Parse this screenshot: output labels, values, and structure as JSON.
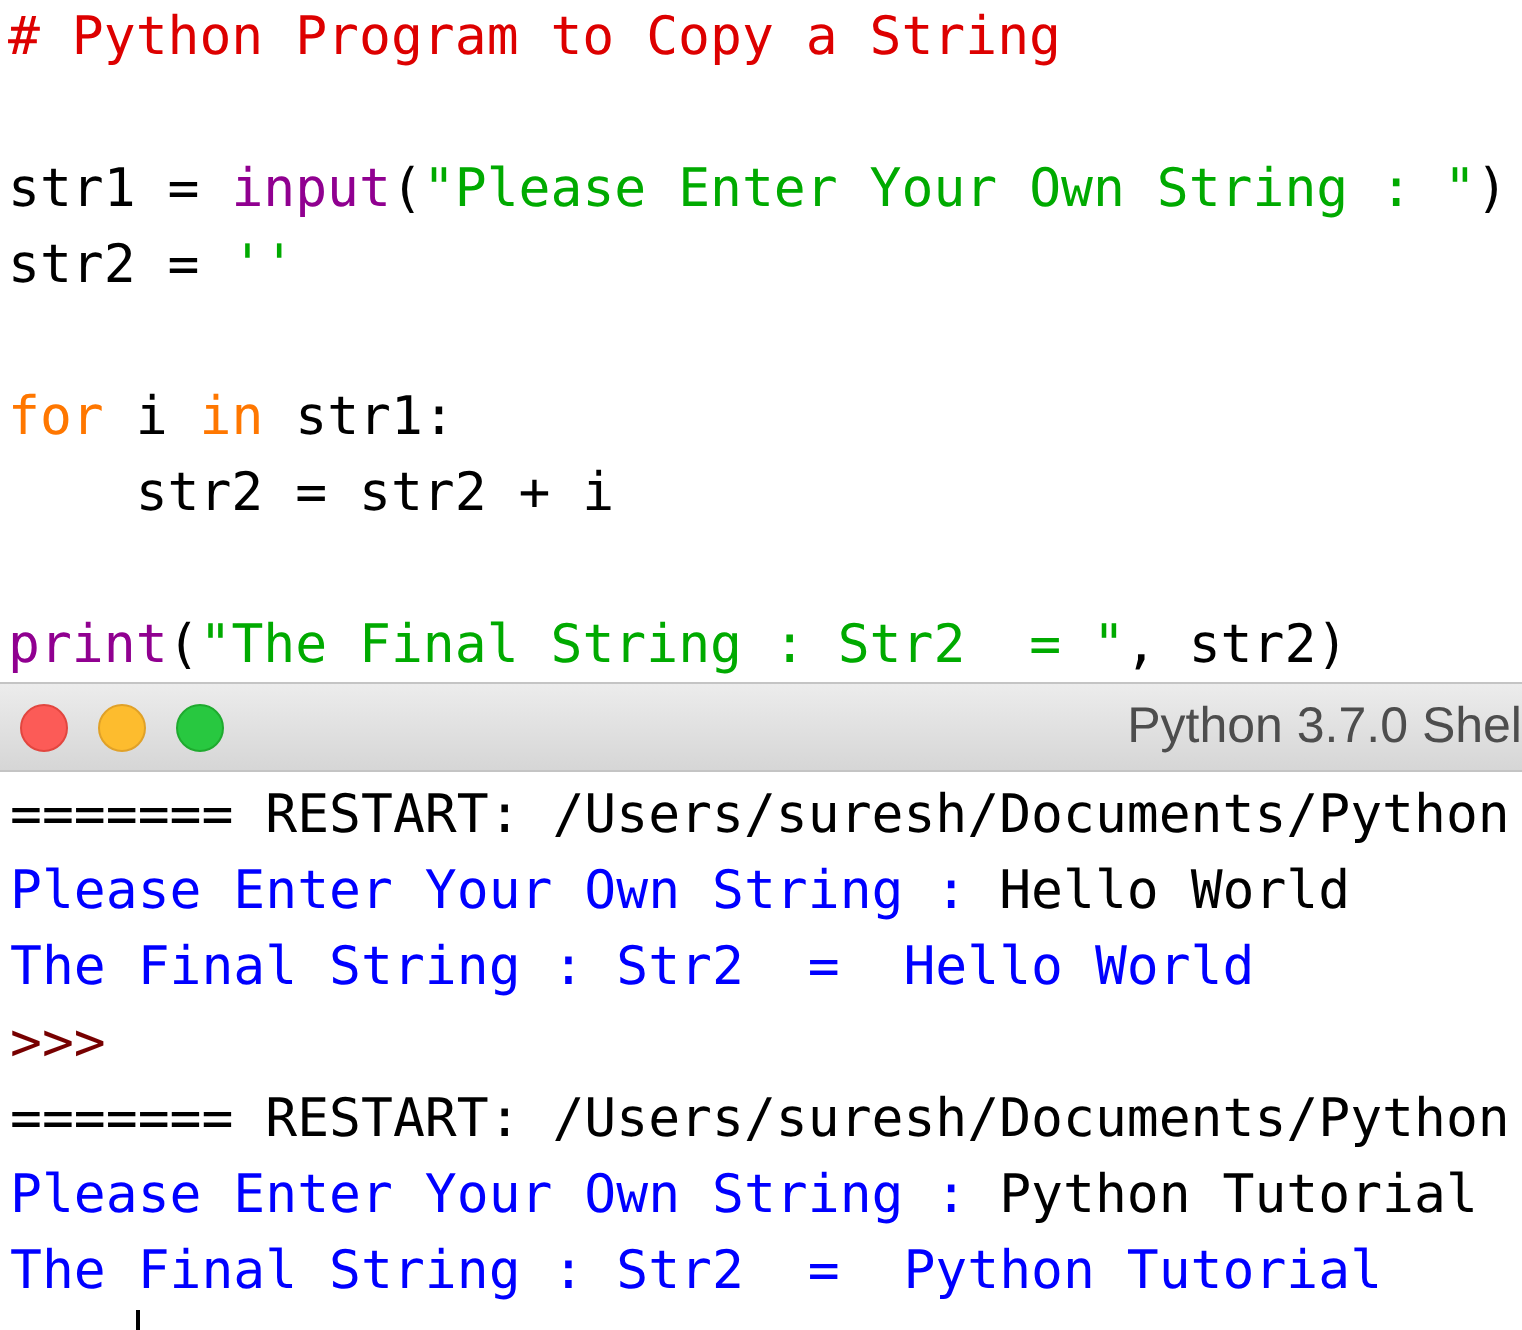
{
  "editor": {
    "lines": [
      {
        "tokens": [
          {
            "kind": "comment",
            "text": "# Python Program to Copy a String"
          }
        ]
      },
      {
        "kind": "blank"
      },
      {
        "tokens": [
          {
            "kind": "plain",
            "text": "str1 = "
          },
          {
            "kind": "builtin",
            "text": "input"
          },
          {
            "kind": "plain",
            "text": "("
          },
          {
            "kind": "string",
            "text": "\"Please Enter Your Own String : \""
          },
          {
            "kind": "plain",
            "text": ")"
          }
        ]
      },
      {
        "tokens": [
          {
            "kind": "plain",
            "text": "str2 = "
          },
          {
            "kind": "string",
            "text": "''"
          }
        ]
      },
      {
        "kind": "blank"
      },
      {
        "tokens": [
          {
            "kind": "keyword",
            "text": "for"
          },
          {
            "kind": "plain",
            "text": " i "
          },
          {
            "kind": "keyword",
            "text": "in"
          },
          {
            "kind": "plain",
            "text": " str1:"
          }
        ]
      },
      {
        "tokens": [
          {
            "kind": "plain",
            "text": "    str2 = str2 + i"
          }
        ]
      },
      {
        "kind": "blank"
      },
      {
        "tokens": [
          {
            "kind": "builtin",
            "text": "print"
          },
          {
            "kind": "plain",
            "text": "("
          },
          {
            "kind": "string",
            "text": "\"The Final String : Str2  = \""
          },
          {
            "kind": "plain",
            "text": ", str2)"
          }
        ]
      }
    ]
  },
  "shell": {
    "title": "Python 3.7.0 Shel",
    "lines": [
      {
        "segments": [
          {
            "kind": "plain",
            "text": "======= RESTART: /Users/suresh/Documents/Python"
          }
        ]
      },
      {
        "segments": [
          {
            "kind": "output",
            "text": "Please Enter Your Own String : "
          },
          {
            "kind": "plain",
            "text": "Hello World"
          }
        ]
      },
      {
        "segments": [
          {
            "kind": "output",
            "text": "The Final String : Str2  =  Hello World"
          }
        ]
      },
      {
        "segments": [
          {
            "kind": "prompt",
            "text": ">>>"
          }
        ]
      },
      {
        "segments": [
          {
            "kind": "plain",
            "text": "======= RESTART: /Users/suresh/Documents/Python"
          }
        ]
      },
      {
        "segments": [
          {
            "kind": "output",
            "text": "Please Enter Your Own String : "
          },
          {
            "kind": "plain",
            "text": "Python Tutorial"
          }
        ]
      },
      {
        "segments": [
          {
            "kind": "output",
            "text": "The Final String : Str2  =  Python Tutorial"
          }
        ]
      }
    ]
  }
}
